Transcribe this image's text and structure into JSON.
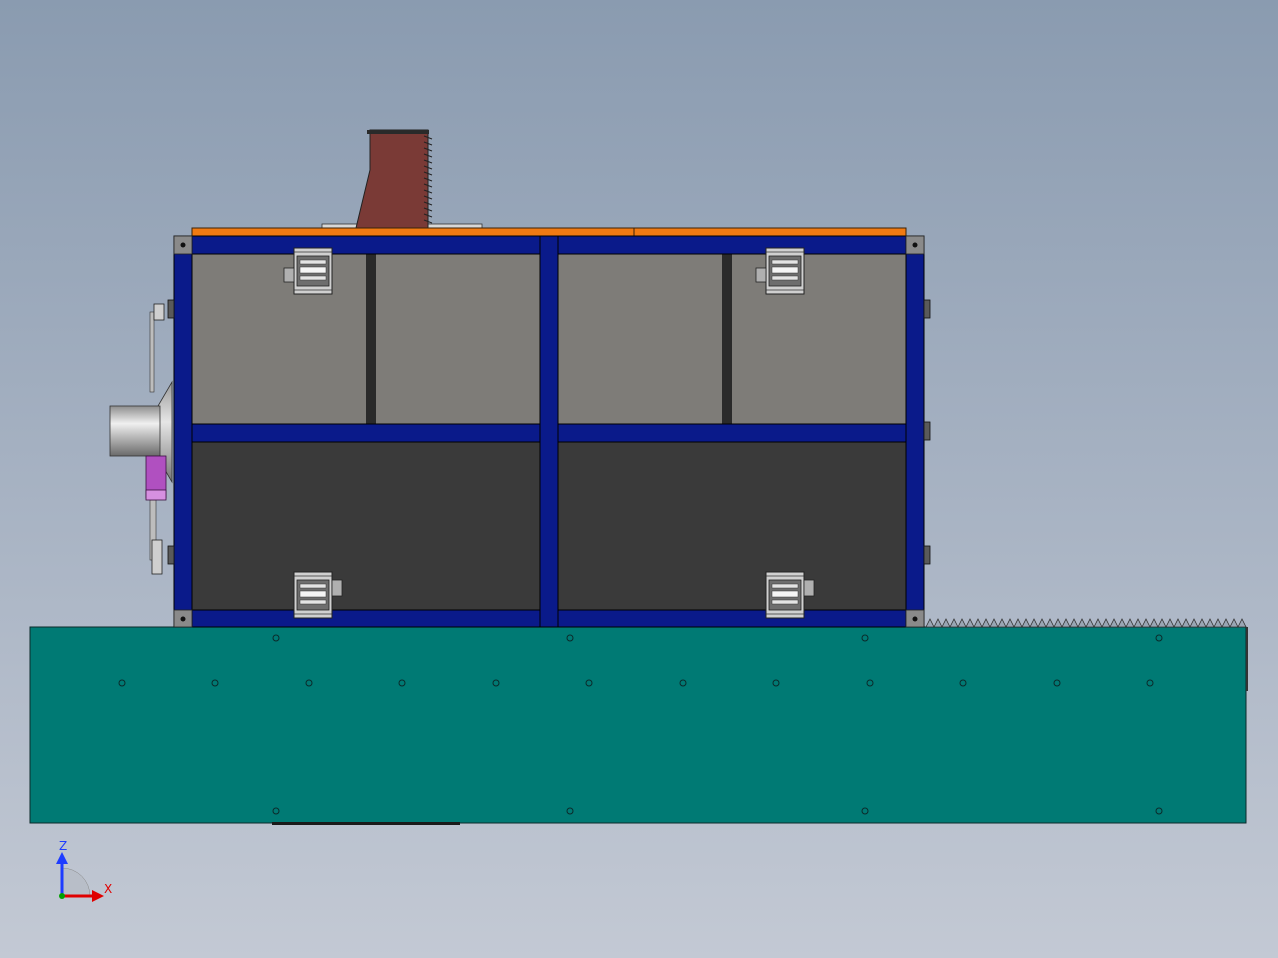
{
  "viewport": {
    "background_top": "#8a9bb0",
    "background_bottom": "#c3c9d4"
  },
  "triad": {
    "z_label": "Z",
    "x_label": "X",
    "z_color": "#1e3cff",
    "x_color": "#e00000",
    "y_color": "#00a000"
  },
  "colors": {
    "frame": "#0a1a8a",
    "panel_upper": "#7e7c78",
    "panel_lower": "#3a3a3a",
    "top_plate": "#f07a12",
    "hopper": "#7a3a36",
    "base": "#007a74",
    "latch": "#c8c8c8",
    "nozzle": "#b8b8b8",
    "motor": "#b050c0"
  },
  "icons": {
    "triad": "axis-triad-icon",
    "latch": "latch-clamp-icon"
  }
}
